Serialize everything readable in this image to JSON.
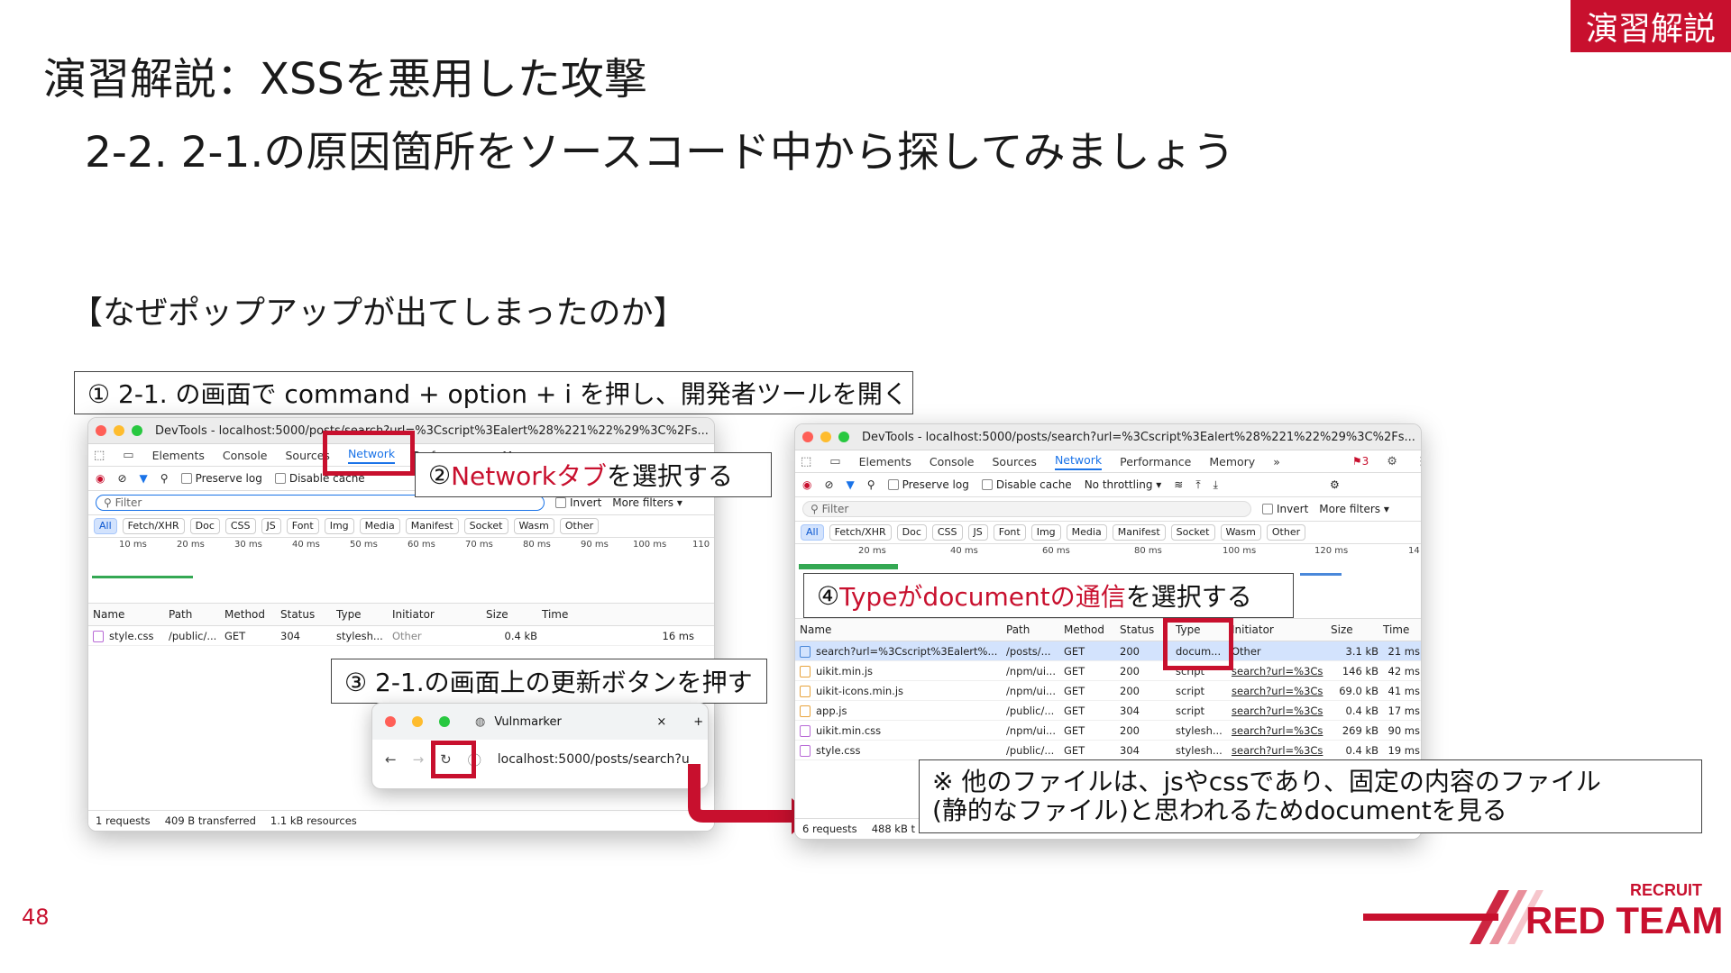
{
  "badge": "演習解説",
  "title": "演習解説：XSSを悪用した攻撃",
  "subtitle": "2-2. 2-1.の原因箇所をソースコード中から探してみましょう",
  "question": "【なぜポップアップが出てしまったのか】",
  "steps": {
    "step1": "① 2-1. の画面で command + option + i を押し、開発者ツールを開く",
    "step2_prefix": "② ",
    "step2_red": "Networkタブ",
    "step2_suffix": "を選択する",
    "step3": "③ 2-1.の画面上の更新ボタンを押す",
    "step4_prefix": "④ ",
    "step4_red": "Typeがdocumentの通信",
    "step4_suffix": "を選択する",
    "note_line1": "※ 他のファイルは、jsやcssであり、固定の内容のファイル",
    "note_line2": "(静的なファイル)と思われるためdocumentを見る"
  },
  "devtools_left": {
    "title": "DevTools - localhost:5000/posts/search?url=%3Cscript%3Ealert%28%221%22%29%3C%2Fs...",
    "tabs": [
      "Elements",
      "Console",
      "Sources",
      "Network",
      "Performance",
      "Memory",
      "»"
    ],
    "preserve_log": "Preserve log",
    "disable_cache": "Disable cache",
    "filter_placeholder": "Filter",
    "invert": "Invert",
    "more_filters": "More filters ▾",
    "types": [
      "All",
      "Fetch/XHR",
      "Doc",
      "CSS",
      "JS",
      "Font",
      "Img",
      "Media",
      "Manifest",
      "Socket",
      "Wasm",
      "Other"
    ],
    "ticks": [
      "10 ms",
      "20 ms",
      "30 ms",
      "40 ms",
      "50 ms",
      "60 ms",
      "70 ms",
      "80 ms",
      "90 ms",
      "100 ms",
      "110"
    ],
    "columns": [
      "Name",
      "Path",
      "Method",
      "Status",
      "Type",
      "Initiator",
      "Size",
      "Time"
    ],
    "rows": [
      {
        "name": "style.css",
        "path": "/public/...",
        "method": "GET",
        "status": "304",
        "type": "stylesh...",
        "initiator": "Other",
        "size": "0.4 kB",
        "time": "16 ms"
      }
    ],
    "status": [
      "1 requests",
      "409 B transferred",
      "1.1 kB resources"
    ]
  },
  "browser": {
    "tab_title": "Vulnmarker",
    "close": "×",
    "plus": "+",
    "url": "localhost:5000/posts/search?u"
  },
  "devtools_right": {
    "title": "DevTools - localhost:5000/posts/search?url=%3Cscript%3Ealert%28%221%22%29%3C%2Fs...",
    "tabs": [
      "Elements",
      "Console",
      "Sources",
      "Network",
      "Performance",
      "Memory",
      "»"
    ],
    "issues": "3",
    "preserve_log": "Preserve log",
    "disable_cache": "Disable cache",
    "throttling": "No throttling ▾",
    "filter_placeholder": "Filter",
    "invert": "Invert",
    "more_filters": "More filters ▾",
    "types": [
      "All",
      "Fetch/XHR",
      "Doc",
      "CSS",
      "JS",
      "Font",
      "Img",
      "Media",
      "Manifest",
      "Socket",
      "Wasm",
      "Other"
    ],
    "ticks": [
      "20 ms",
      "40 ms",
      "60 ms",
      "80 ms",
      "100 ms",
      "120 ms",
      "14"
    ],
    "columns": [
      "Name",
      "Path",
      "Method",
      "Status",
      "Type",
      "Initiator",
      "Size",
      "Time"
    ],
    "rows": [
      {
        "name": "search?url=%3Cscript%3Ealert%...",
        "path": "/posts/...",
        "method": "GET",
        "status": "200",
        "type": "docum...",
        "initiator": "Other",
        "size": "3.1 kB",
        "time": "21 ms"
      },
      {
        "name": "uikit.min.js",
        "path": "/npm/ui...",
        "method": "GET",
        "status": "200",
        "type": "script",
        "initiator": "search?url=%3Cs",
        "size": "146 kB",
        "time": "42 ms"
      },
      {
        "name": "uikit-icons.min.js",
        "path": "/npm/ui...",
        "method": "GET",
        "status": "200",
        "type": "script",
        "initiator": "search?url=%3Cs",
        "size": "69.0 kB",
        "time": "41 ms"
      },
      {
        "name": "app.js",
        "path": "/public/...",
        "method": "GET",
        "status": "304",
        "type": "script",
        "initiator": "search?url=%3Cs",
        "size": "0.4 kB",
        "time": "17 ms"
      },
      {
        "name": "uikit.min.css",
        "path": "/npm/ui...",
        "method": "GET",
        "status": "200",
        "type": "stylesh...",
        "initiator": "search?url=%3Cs",
        "size": "269 kB",
        "time": "90 ms"
      },
      {
        "name": "style.css",
        "path": "/public/...",
        "method": "GET",
        "status": "304",
        "type": "stylesh...",
        "initiator": "search?url=%3Cs",
        "size": "0.4 kB",
        "time": "19 ms"
      }
    ],
    "status": [
      "6 requests",
      "488 kB t"
    ]
  },
  "logo": {
    "recruit": "RECRUIT",
    "team": "RED TEAM"
  },
  "page_number": "48",
  "colors": {
    "accent_red": "#c8102e",
    "devtools_blue": "#1a73e8"
  }
}
